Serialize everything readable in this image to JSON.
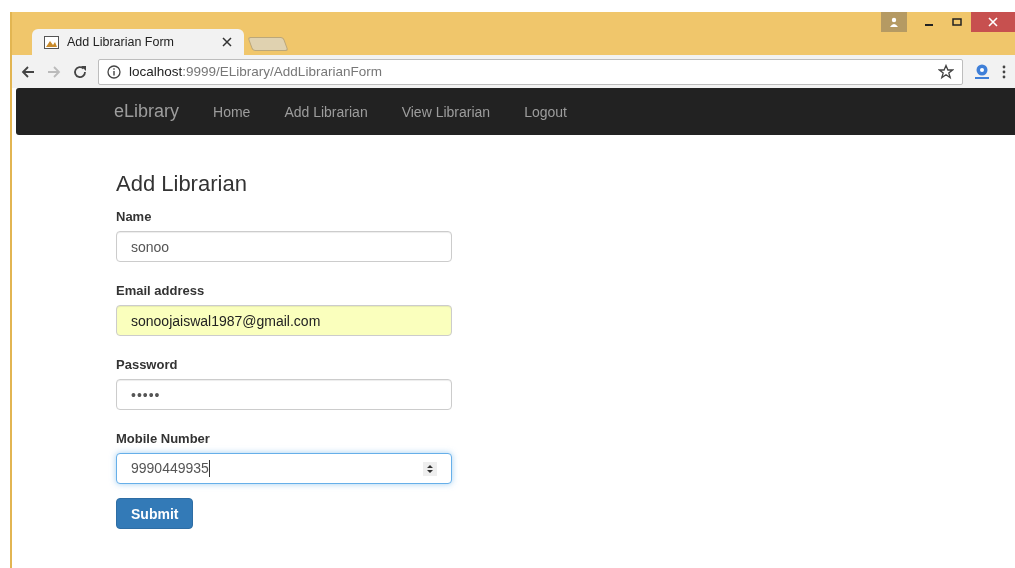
{
  "browser": {
    "tabs": [
      {
        "title": "Add Librarian Form",
        "selected": true
      }
    ],
    "forward_disabled": true,
    "url": {
      "host": "localhost",
      "path": ":9999/ELibrary/AddLibrarianForm"
    }
  },
  "navbar": {
    "brand": "eLibrary",
    "links": [
      {
        "label": "Home"
      },
      {
        "label": "Add Librarian"
      },
      {
        "label": "View Librarian"
      },
      {
        "label": "Logout"
      }
    ]
  },
  "form": {
    "title": "Add Librarian",
    "fields": [
      {
        "label": "Name",
        "kind": "text",
        "value": "sonoo",
        "autofilled": false,
        "focused": false
      },
      {
        "label": "Email address",
        "kind": "text",
        "value": "sonoojaiswal1987@gmail.com",
        "autofilled": true,
        "focused": false
      },
      {
        "label": "Password",
        "kind": "password",
        "value": "•••••",
        "autofilled": false,
        "focused": false
      },
      {
        "label": "Mobile Number",
        "kind": "number",
        "value": "9990449935",
        "autofilled": false,
        "focused": true
      }
    ],
    "submit": "Submit"
  }
}
